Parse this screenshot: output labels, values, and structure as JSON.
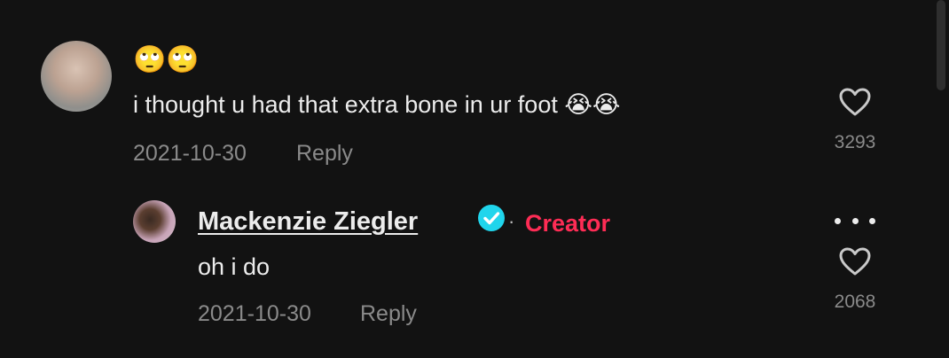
{
  "comment": {
    "emoji": "🙄🙄",
    "text": "i thought u had that extra bone in ur foot 😭😭",
    "date": "2021-10-30",
    "reply_label": "Reply",
    "likes": "3293"
  },
  "reply": {
    "username": "Mackenzie Ziegler",
    "badge": "Creator",
    "separator": "·",
    "text": "oh i do",
    "date": "2021-10-30",
    "reply_label": "Reply",
    "likes": "2068"
  },
  "colors": {
    "background": "#121212",
    "text": "#ececec",
    "muted": "#8a8a8a",
    "creator_accent": "#fe2c55",
    "verified": "#20d5ec"
  },
  "icons": {
    "like": "heart-icon",
    "verified": "verified-check-icon",
    "more": "more-options-icon"
  }
}
